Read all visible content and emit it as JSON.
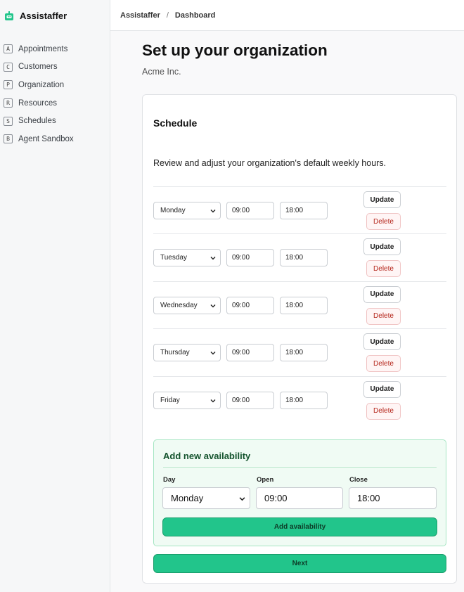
{
  "app": {
    "name": "Assistaffer"
  },
  "sidebar": {
    "items": [
      {
        "key": "A",
        "label": "Appointments"
      },
      {
        "key": "C",
        "label": "Customers"
      },
      {
        "key": "P",
        "label": "Organization"
      },
      {
        "key": "R",
        "label": "Resources"
      },
      {
        "key": "S",
        "label": "Schedules"
      },
      {
        "key": "B",
        "label": "Agent Sandbox"
      }
    ]
  },
  "breadcrumb": {
    "root": "Assistaffer",
    "separator": "/",
    "current": "Dashboard"
  },
  "page": {
    "title": "Set up your organization",
    "org_name": "Acme Inc."
  },
  "schedule": {
    "title": "Schedule",
    "description": "Review and adjust your organization's default weekly hours.",
    "update_label": "Update",
    "delete_label": "Delete",
    "rows": [
      {
        "day": "Monday",
        "open": "09:00",
        "close": "18:00"
      },
      {
        "day": "Tuesday",
        "open": "09:00",
        "close": "18:00"
      },
      {
        "day": "Wednesday",
        "open": "09:00",
        "close": "18:00"
      },
      {
        "day": "Thursday",
        "open": "09:00",
        "close": "18:00"
      },
      {
        "day": "Friday",
        "open": "09:00",
        "close": "18:00"
      }
    ]
  },
  "availability": {
    "title": "Add new availability",
    "day_label": "Day",
    "open_label": "Open",
    "close_label": "Close",
    "day_value": "Monday",
    "open_value": "09:00",
    "close_value": "18:00",
    "add_label": "Add availability"
  },
  "next_label": "Next",
  "colors": {
    "accent": "#22c58b",
    "danger": "#b42318"
  },
  "icons": {
    "logo": "robot-icon",
    "select": "chevron-down-icon"
  }
}
